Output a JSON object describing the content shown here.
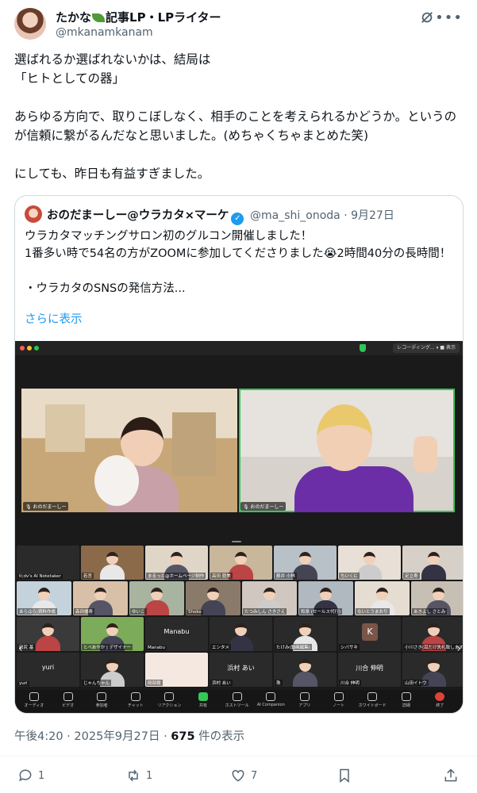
{
  "author": {
    "name_part1": "たかな",
    "name_part2": "記事LP・LPライター",
    "handle": "@mkanamkanam"
  },
  "tweet": {
    "line1": "選ばれるか選ばれないかは、結局は",
    "line2": "「ヒトとしての器」",
    "para2": "あらゆる方向で、取りこぼしなく、相手のことを考えられるかどうか。というのが信頼に繋がるんだなと思いました。(めちゃくちゃまとめた笑)",
    "para3": "にしても、昨日も有益すぎました。"
  },
  "quote": {
    "name": "おのだまーしー@ウラカタ×マーケ",
    "handle_date": "@ma_shi_onoda · 9月27日",
    "line1": "ウラカタマッチングサロン初のグルコン開催しました！",
    "line2": "1番多い時で54名の方がZOOMに参加してくださりました😭2時間40分の長時間！",
    "line3": "・ウラカタのSNSの発信方法...",
    "show_more": "さらに表示"
  },
  "zoom": {
    "recording": "レコーディング... ⏸ ■  表示",
    "speaker1_label": "🎙 おのだまーしー",
    "speaker2_label": "🎙 おのだまーしー",
    "tiles": [
      "tl;dv's AI Notetaker",
      "若宮",
      "まるっと@ホームページ制作",
      "高田 亜美",
      "藤井 小林",
      "ちいくに",
      "足立寿",
      "あらはら|資料作成",
      "森田優寿",
      "ゆいこ",
      "Shoko",
      "たつみしん さきさえ",
      "和泉 (セールス代行)",
      "ないとうまおり",
      "あきよし さとみ",
      "田尻 基",
      "とべあやか | デザイナー",
      "Manabu",
      "エンタメ",
      "たけみ(動画編集)",
      "シバサキ",
      "小川さき(耳だけ失礼致します)",
      "yuri",
      "じゃんちゃん",
      "岡部樹",
      "浜村 あい",
      "珠",
      "川合 伸明",
      "山田イトウ"
    ],
    "tile_names": {
      "manabu": "Manabu",
      "yuri": "yuri",
      "hamamura": "浜村 あい",
      "kawai": "川合 伸明",
      "k_letter": "K"
    },
    "toolbar": [
      "オーディオ",
      "ビデオ",
      "参加者",
      "チャット",
      "リアクション",
      "共有",
      "ホストツール",
      "AI Companion",
      "アプリ",
      "ノート",
      "ホワイトボード",
      "詳細",
      "終了"
    ]
  },
  "meta": {
    "time": "午後4:20 · 2025年9月27日 · ",
    "views": "675",
    "views_suffix": " 件の表示"
  },
  "actions": {
    "replies": "1",
    "reposts": "1",
    "likes": "7"
  }
}
